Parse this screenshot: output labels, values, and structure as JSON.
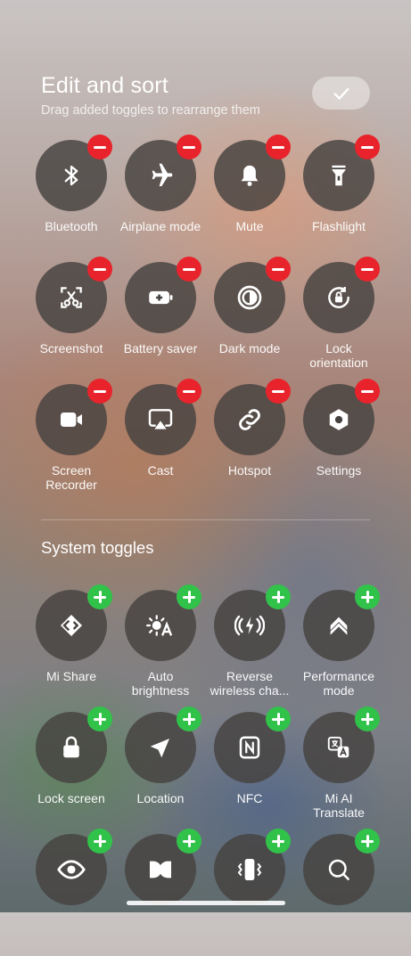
{
  "header": {
    "title": "Edit and sort",
    "subtitle": "Drag added toggles to rearrange them",
    "done_icon": "check-icon"
  },
  "added_toggles": [
    {
      "label": "Bluetooth",
      "icon": "bluetooth-icon"
    },
    {
      "label": "Airplane mode",
      "icon": "airplane-icon"
    },
    {
      "label": "Mute",
      "icon": "bell-icon"
    },
    {
      "label": "Flashlight",
      "icon": "flashlight-icon"
    },
    {
      "label": "Screenshot",
      "icon": "screenshot-scissors-icon"
    },
    {
      "label": "Battery saver",
      "icon": "battery-plus-icon"
    },
    {
      "label": "Dark mode",
      "icon": "dark-mode-icon"
    },
    {
      "label": "Lock\norientation",
      "icon": "lock-rotation-icon"
    },
    {
      "label": "Screen\nRecorder",
      "icon": "video-camera-icon"
    },
    {
      "label": "Cast",
      "icon": "cast-icon"
    },
    {
      "label": "Hotspot",
      "icon": "link-icon"
    },
    {
      "label": "Settings",
      "icon": "gear-icon"
    }
  ],
  "system_section": {
    "title": "System toggles"
  },
  "system_toggles": [
    {
      "label": "Mi Share",
      "icon": "mi-share-icon"
    },
    {
      "label": "Auto\nbrightness",
      "icon": "auto-brightness-icon"
    },
    {
      "label": "Reverse\nwireless cha...",
      "icon": "reverse-wireless-icon"
    },
    {
      "label": "Performance\nmode",
      "icon": "double-chevron-up-icon"
    },
    {
      "label": "Lock screen",
      "icon": "lock-icon"
    },
    {
      "label": "Location",
      "icon": "location-arrow-icon"
    },
    {
      "label": "NFC",
      "icon": "nfc-icon"
    },
    {
      "label": "Mi AI\nTranslate",
      "icon": "translate-icon"
    },
    {
      "label": "",
      "icon": "eye-icon"
    },
    {
      "label": "",
      "icon": "dolby-icon"
    },
    {
      "label": "",
      "icon": "vibrate-icon"
    },
    {
      "label": "",
      "icon": "search-icon"
    }
  ],
  "colors": {
    "remove_badge": "#e8232b",
    "add_badge": "#31c24a",
    "tile": "#46423f"
  }
}
